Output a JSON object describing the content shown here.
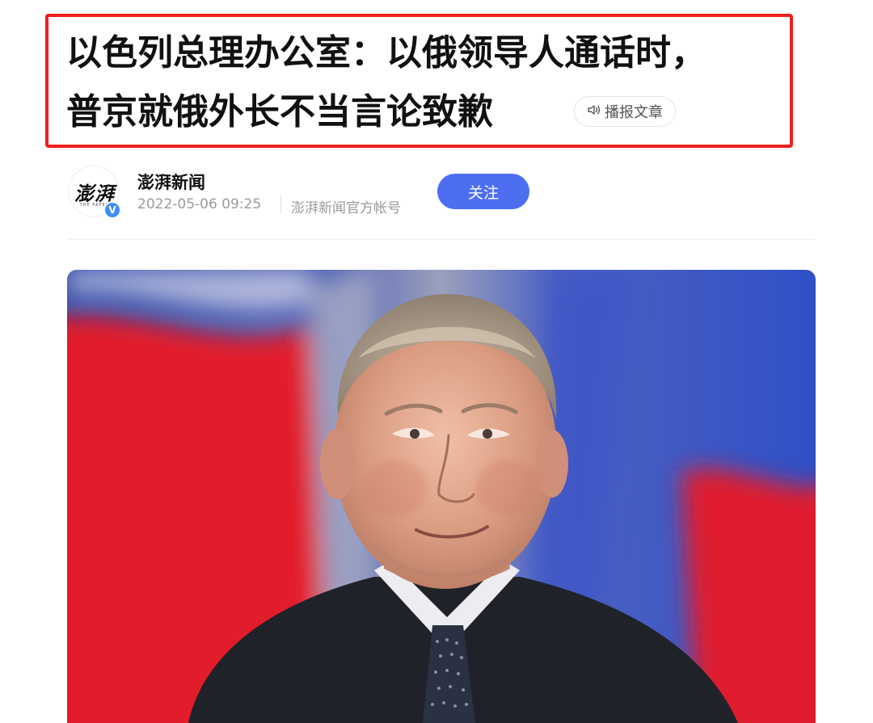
{
  "article": {
    "title_line1": "以色列总理办公室：以俄领导人通话时，",
    "title_line2": "普京就俄外长不当言论致歉",
    "listen_label": "播报文章"
  },
  "author": {
    "avatar_text": "澎湃",
    "avatar_subtext": "THE PAPER",
    "name": "澎湃新闻",
    "published": "2022-05-06 09:25",
    "account_desc": "澎湃新闻官方帐号",
    "follow_label": "关注",
    "verified_mark": "V"
  },
  "colors": {
    "highlight_border": "#f01e1e",
    "follow_button": "#4e6ef2",
    "verified_badge": "#3f8ef5"
  },
  "icons": {
    "listen": "speaker-icon",
    "verified": "verified-badge-icon"
  }
}
